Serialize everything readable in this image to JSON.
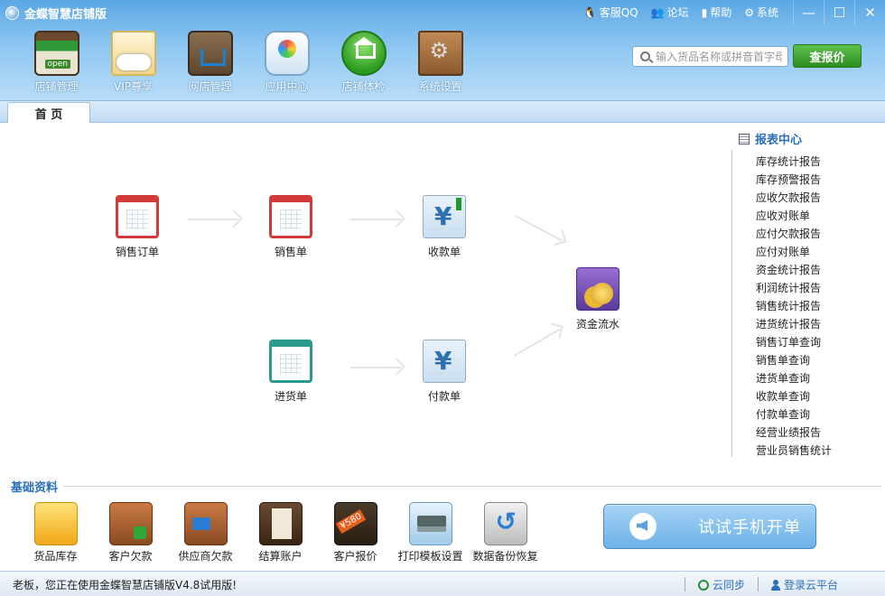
{
  "app": {
    "title": "金蝶智慧店铺版"
  },
  "top_links": [
    {
      "label": "客服QQ",
      "icon": "penguin-icon"
    },
    {
      "label": "论坛",
      "icon": "people-icon"
    },
    {
      "label": "帮助",
      "icon": "book-icon"
    },
    {
      "label": "系统",
      "icon": "gear-icon"
    }
  ],
  "window_controls": {
    "minimize": "—",
    "maximize": "☐",
    "close": "✕"
  },
  "nav": [
    {
      "label": "店铺管理",
      "icon": "storefront-icon"
    },
    {
      "label": "VIP尊享",
      "icon": "vip-card-icon"
    },
    {
      "label": "网店管理",
      "icon": "cart-icon"
    },
    {
      "label": "应用中心",
      "icon": "app-bag-icon"
    },
    {
      "label": "店铺体检",
      "icon": "home-check-icon"
    },
    {
      "label": "系统设置",
      "icon": "toolbox-icon"
    }
  ],
  "search": {
    "placeholder": "输入货品名称或拼音首字母",
    "button_label": "查报价"
  },
  "tabs": [
    {
      "label": "首 页"
    }
  ],
  "flow": {
    "sales_order": "销售订单",
    "sales_bill": "销售单",
    "receipt": "收款单",
    "cash_flow": "资金流水",
    "purchase": "进货单",
    "payment": "付款单"
  },
  "report_center": {
    "title": "报表中心",
    "items": [
      "库存统计报告",
      "库存预警报告",
      "应收欠款报告",
      "应收对账单",
      "应付欠款报告",
      "应付对账单",
      "资金统计报告",
      "利润统计报告",
      "销售统计报告",
      "进货统计报告",
      "销售订单查询",
      "销售单查询",
      "进货单查询",
      "收款单查询",
      "付款单查询",
      "经营业绩报告",
      "营业员销售统计"
    ]
  },
  "basic_data": {
    "title": "基础资料",
    "items": [
      {
        "label": "货品库存",
        "icon": "boxes-icon"
      },
      {
        "label": "客户欠款",
        "icon": "wallet-in-icon"
      },
      {
        "label": "供应商欠款",
        "icon": "wallet-out-icon"
      },
      {
        "label": "结算账户",
        "icon": "ledger-icon"
      },
      {
        "label": "客户报价",
        "icon": "price-tag-icon"
      },
      {
        "label": "打印模板设置",
        "icon": "printer-icon"
      },
      {
        "label": "数据备份恢复",
        "icon": "backup-icon"
      }
    ]
  },
  "mobile_button": {
    "label": "试试手机开单"
  },
  "status": {
    "text": "老板，您正在使用金蝶智慧店铺版V4.8试用版!",
    "cloud_sync": "云同步",
    "login_cloud": "登录云平台"
  }
}
